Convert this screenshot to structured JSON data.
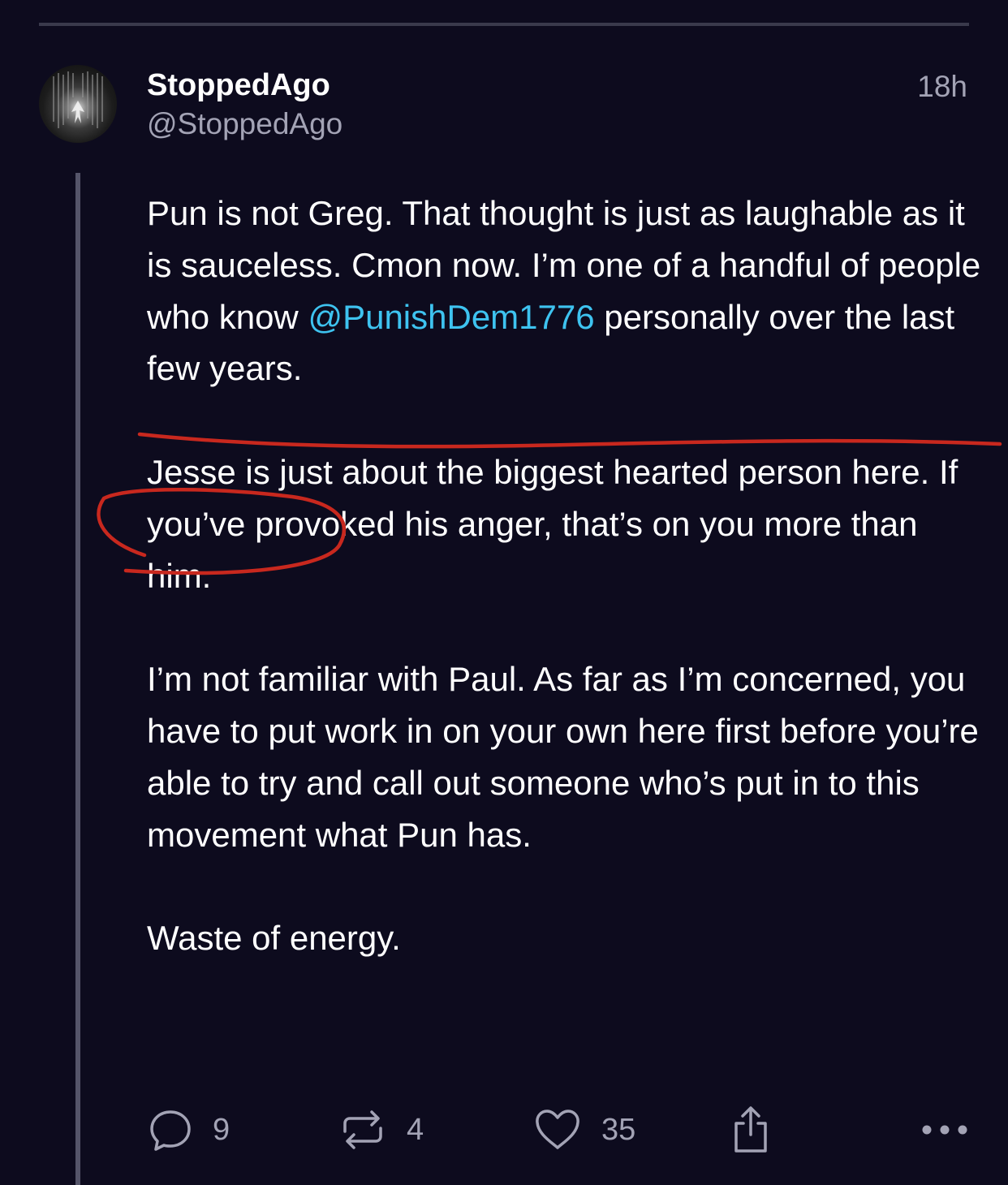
{
  "post": {
    "display_name": "StoppedAgo",
    "handle": "@StoppedAgo",
    "timestamp": "18h",
    "paragraphs": [
      {
        "before": "Pun is not Greg. That thought is just as laughable as it is sauceless. Cmon now. I’m one of a handful of people who know ",
        "mention": "@PunishDem1776",
        "after": " personally over the last few years."
      },
      {
        "text": "Jesse is just about the biggest hearted person here. If you’ve provoked his anger, that’s on you more than him."
      },
      {
        "text": "I’m not familiar with Paul. As far as I’m concerned, you have to put work in on your own here first before you’re able to try and call out someone who’s put in to this movement what Pun has."
      },
      {
        "text": "Waste of energy."
      }
    ]
  },
  "actions": {
    "replies": "9",
    "reposts": "4",
    "likes": "35"
  },
  "icons": {
    "reply": "speech-bubble-icon",
    "repost": "repost-arrows-icon",
    "like": "heart-icon",
    "share": "share-upload-icon",
    "more": "more-dots-icon"
  },
  "colors": {
    "background": "#0d0b1e",
    "text": "#ffffff",
    "muted": "#a3a3b5",
    "mention": "#3ec3f0",
    "annotation": "#c8281e"
  }
}
